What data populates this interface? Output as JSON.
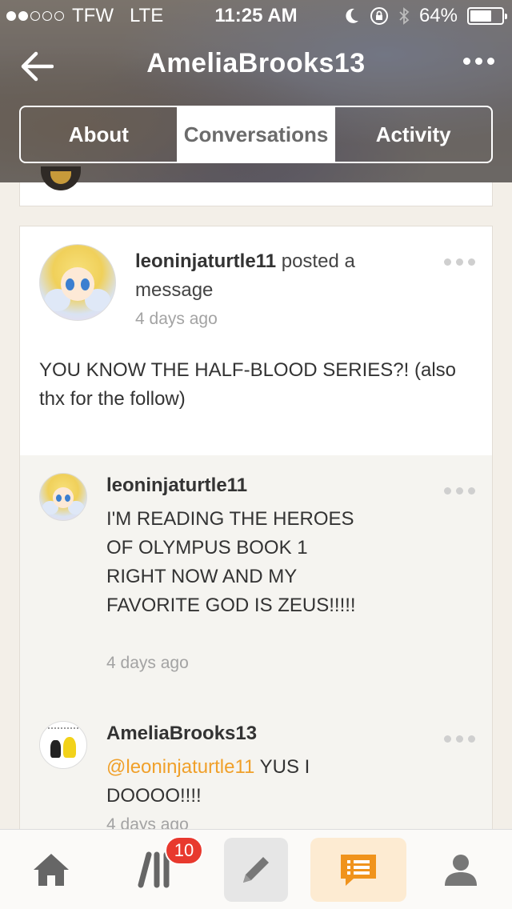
{
  "status_bar": {
    "carrier": "TFW",
    "network": "LTE",
    "time": "11:25 AM",
    "battery": "64%",
    "signal_bars_filled": 2,
    "signal_bars_total": 5
  },
  "nav": {
    "title": "AmeliaBrooks13",
    "back_icon": "arrow-left-icon",
    "more_icon": "more-horizontal-icon"
  },
  "tabs": [
    {
      "label": "About",
      "active": false
    },
    {
      "label": "Conversations",
      "active": true
    },
    {
      "label": "Activity",
      "active": false
    }
  ],
  "post": {
    "username": "leoninjaturtle11",
    "action": " posted a message",
    "time": "4 days ago",
    "text": "YOU KNOW THE HALF-BLOOD SERIES?! (also thx for the follow)"
  },
  "comments": [
    {
      "username": "leoninjaturtle11",
      "text": "I'M READING THE HEROES OF OLYMPUS BOOK 1 RIGHT NOW AND MY FAVORITE GOD IS ZEUS!!!!!",
      "time": "4 days ago"
    },
    {
      "username": "AmeliaBrooks13",
      "mention": "@leoninjaturtle11",
      "text": " YUS I DOOOO!!!!",
      "time": "4 days ago"
    }
  ],
  "tabbar": {
    "items": [
      {
        "icon": "home-icon"
      },
      {
        "icon": "library-icon"
      },
      {
        "icon": "pencil-icon"
      },
      {
        "icon": "chat-list-icon"
      },
      {
        "icon": "profile-icon"
      }
    ],
    "badge": "10"
  },
  "colors": {
    "accent": "#f0931c",
    "mention": "#f0a02a",
    "badge": "#e8392e"
  }
}
